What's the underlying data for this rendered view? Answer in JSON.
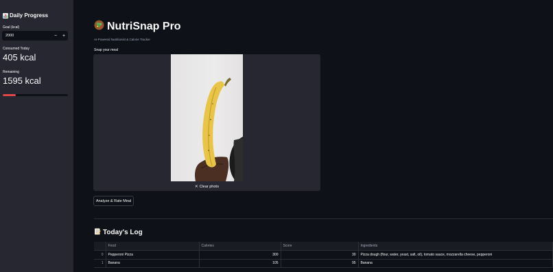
{
  "sidebar": {
    "title": "Daily Progress",
    "goal_label": "Goal (kcal)",
    "goal_value": "2000",
    "stepper_minus": "−",
    "stepper_plus": "+",
    "consumed_label": "Consumed Today",
    "consumed_value": "405 kcal",
    "remaining_label": "Remaining",
    "remaining_value": "1595 kcal",
    "progress_fraction": 0.2025,
    "progress_color": "#e0474c"
  },
  "main": {
    "title": "NutriSnap Pro",
    "title_icon": "salad-bowl-icon",
    "subtitle": "AI-Powered Nutritionist & Calorie Tracker",
    "uploader_label": "Snap your meal",
    "clear_label": "Clear photo",
    "analyze_label": "Analyze & Rate Meal",
    "log_title": "Today's Log",
    "log_icon": "memo-icon"
  },
  "log": {
    "columns": [
      "",
      "Food",
      "Calories",
      "Score",
      "Ingredients"
    ],
    "rows": [
      {
        "index": "0",
        "food": "Pepperoni Pizza",
        "calories": "300",
        "score": "30",
        "ingredients": "Pizza dough (flour, water, yeast, salt, oil), tomato sauce, mozzarella cheese, pepperoni"
      },
      {
        "index": "1",
        "food": "Banana",
        "calories": "105",
        "score": "95",
        "ingredients": "Banana"
      }
    ]
  }
}
